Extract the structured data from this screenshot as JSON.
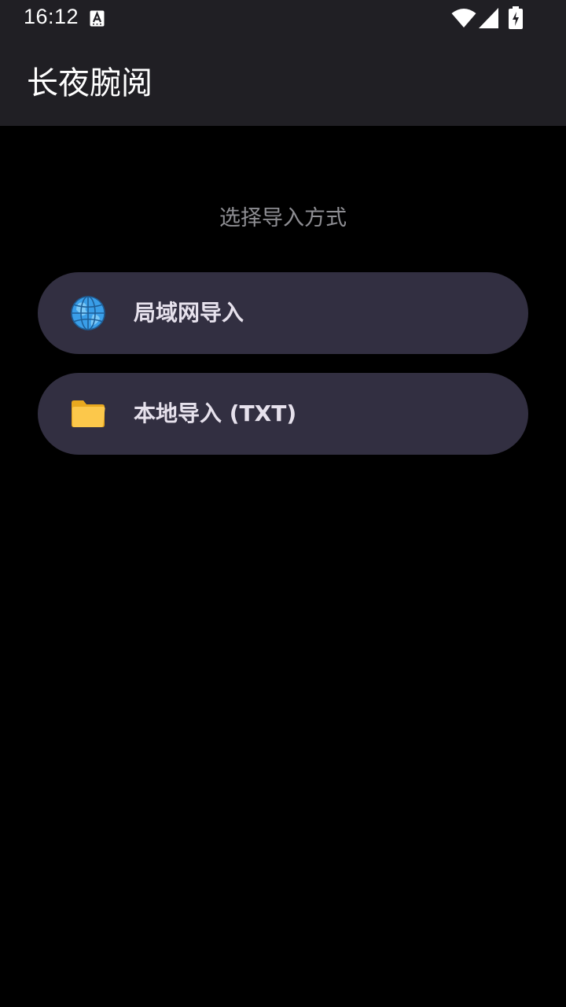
{
  "status_bar": {
    "time": "16:12",
    "icons": [
      "a-notification-icon",
      "wifi-icon",
      "signal-icon",
      "battery-charging-icon"
    ]
  },
  "app_bar": {
    "title": "长夜腕阅"
  },
  "main": {
    "subtitle": "选择导入方式",
    "options": [
      {
        "icon": "globe-icon",
        "label": "局域网导入"
      },
      {
        "icon": "folder-icon",
        "label": "本地导入 (TXT)"
      }
    ]
  },
  "colors": {
    "bar_background": "#201f24",
    "page_background": "#000000",
    "button_background": "#322f41",
    "button_text": "#e6e1ec",
    "subtitle_text": "#8e8e93"
  }
}
